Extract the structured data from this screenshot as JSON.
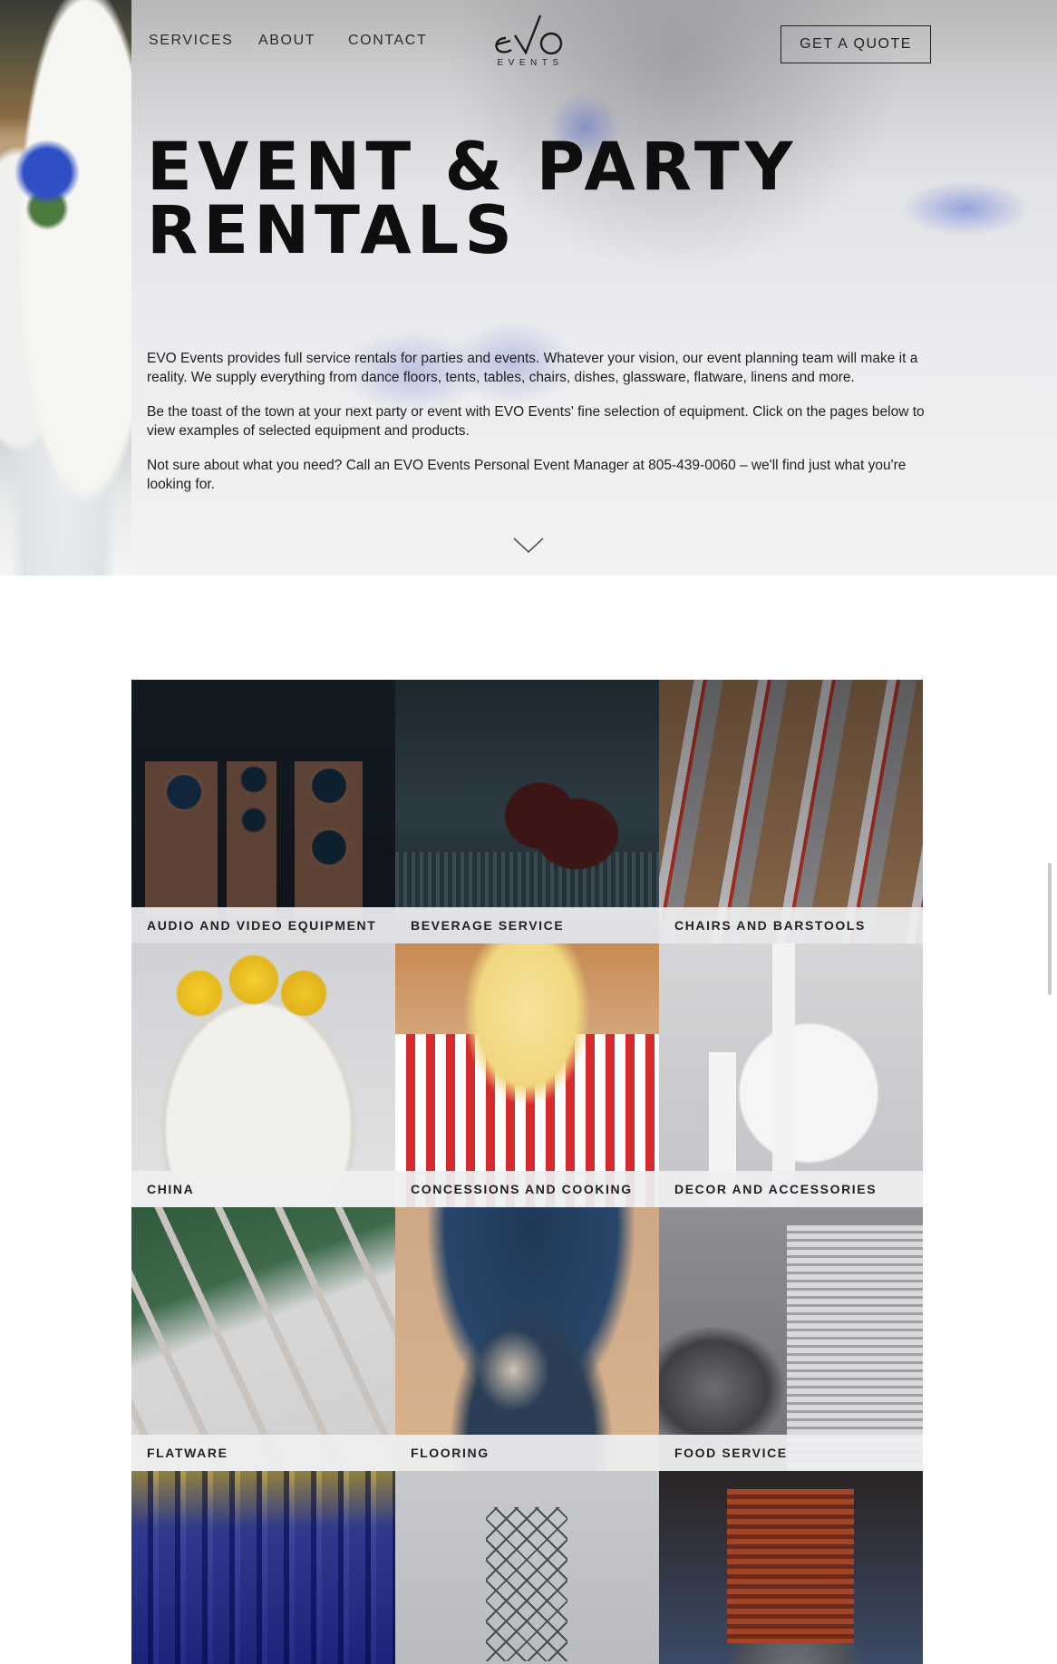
{
  "header": {
    "nav": [
      "SERVICES",
      "ABOUT",
      "CONTACT"
    ],
    "logo_text": "eVo",
    "logo_subtext": "EVENTS",
    "cta_label": "GET A QUOTE"
  },
  "hero": {
    "title_line1": "EVENT & PARTY",
    "title_line2": "RENTALS",
    "paragraphs": [
      "EVO Events provides full service rentals for parties and events. Whatever your vision, our event planning team will make it a reality. We supply everything from dance floors, tents, tables, chairs, dishes, glassware, flatware, linens and more.",
      "Be the toast of the town at your next party or event with EVO Events' fine selection of equipment. Click on the pages below to view examples of selected equipment and products.",
      "Not sure about what you need? Call an EVO Events Personal Event Manager at 805-439-0060 – we'll find just what you're looking for."
    ],
    "scroll_icon": "chevron-down-icon"
  },
  "categories": [
    {
      "label": "AUDIO AND VIDEO EQUIPMENT"
    },
    {
      "label": "BEVERAGE SERVICE"
    },
    {
      "label": "CHAIRS AND BARSTOOLS"
    },
    {
      "label": "CHINA"
    },
    {
      "label": "CONCESSIONS AND COOKING"
    },
    {
      "label": "DECOR AND ACCESSORIES"
    },
    {
      "label": "FLATWARE"
    },
    {
      "label": "FLOORING"
    },
    {
      "label": "FOOD SERVICE"
    },
    {
      "label": ""
    },
    {
      "label": ""
    },
    {
      "label": ""
    }
  ],
  "colors": {
    "text": "#1e1e1e",
    "label_bg": "#eeeff1",
    "accent_blue": "#2f4fc4"
  }
}
